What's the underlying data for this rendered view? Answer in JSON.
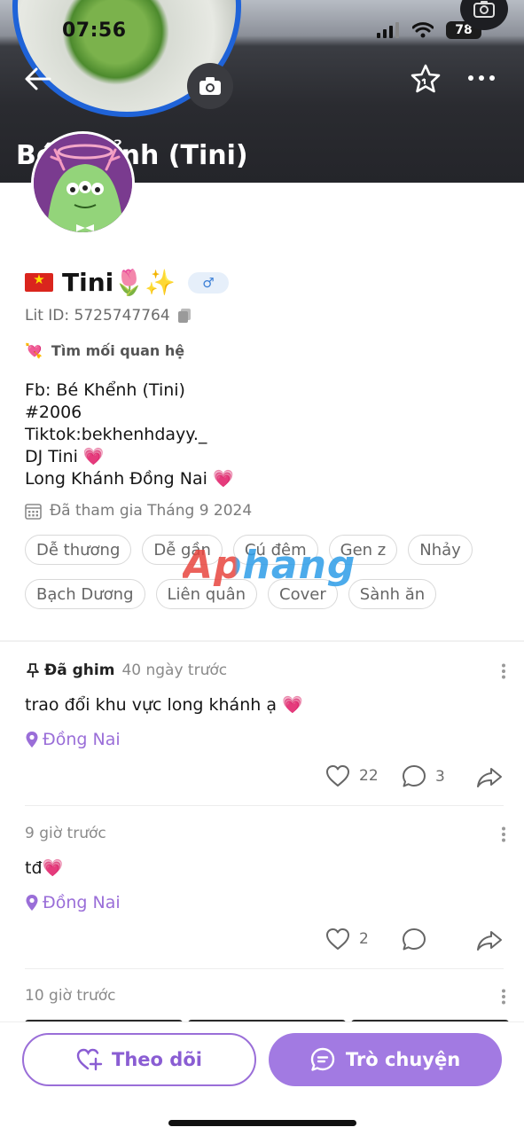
{
  "status_bar": {
    "time": "07:56",
    "battery": "78"
  },
  "header": {
    "name": "Bé Khểnh (Tini)"
  },
  "profile": {
    "name": "Tini🌷✨",
    "gender_symbol": "♂",
    "lit_id": "Lit ID: 5725747764",
    "seeking": "Tìm mối quan hệ",
    "seeking_emoji": "💘",
    "bio": [
      "Fb: Bé Khểnh (Tini)",
      "#2006",
      "Tiktok:bekhenhdayy._",
      "DJ Tini 💗",
      "Long Khánh Đồng Nai 💗"
    ],
    "joined": "Đã tham gia Tháng 9 2024",
    "tags": [
      "Dễ thương",
      "Dễ gần",
      "Cú đêm",
      "Gen z",
      "Nhảy",
      "Bạch Dương",
      "Liên quân",
      "Cover",
      "Sành ăn"
    ]
  },
  "watermark": "Aphang",
  "posts": [
    {
      "pinned_label": "Đã ghim",
      "time": "40 ngày trước",
      "text": "trao đổi khu vực long khánh ạ 💗",
      "location": "Đồng Nai",
      "likes": "22",
      "comments": "3"
    },
    {
      "time": "9 giờ trước",
      "text": "tđ💗",
      "location": "Đồng Nai",
      "likes": "2",
      "comments": ""
    },
    {
      "time": "10 giờ trước"
    }
  ],
  "actions": {
    "follow": "Theo dõi",
    "chat": "Trò chuyện"
  },
  "colors": {
    "accent": "#a27ae2",
    "accent_dark": "#8a5dd3",
    "gender_badge": "#3b7fd6",
    "header_bg": "#24252a",
    "avatar_ring": "#1f63d8"
  }
}
